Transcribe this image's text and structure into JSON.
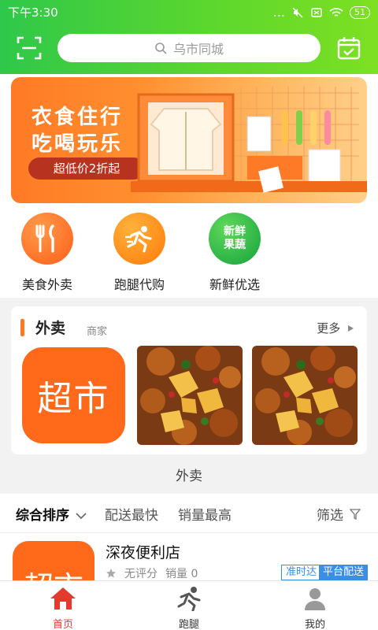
{
  "status_bar": {
    "time": "下午3:30",
    "signal": "...",
    "battery": "51"
  },
  "header": {
    "search_placeholder": "乌市同城",
    "scan_icon": "scan-icon",
    "calendar_icon": "calendar-icon"
  },
  "banner": {
    "line1": "衣食住行",
    "line2": "吃喝玩乐",
    "promo": "超低价2折起"
  },
  "categories": [
    {
      "label": "美食外卖",
      "icon": "fork-knife-icon",
      "color": "#ff6d1f"
    },
    {
      "label": "跑腿代购",
      "icon": "runner-icon",
      "color": "#ff8a14"
    },
    {
      "label": "新鲜优选",
      "icon": "fresh-produce-icon",
      "color": "#22b14c",
      "badge": "新鲜\n果蔬"
    }
  ],
  "takeaway_card": {
    "title": "外卖",
    "subtitle": "商家",
    "more": "更多",
    "items": [
      {
        "text": "超市"
      },
      {
        "kind": "food-photo"
      },
      {
        "kind": "food-photo"
      }
    ]
  },
  "section_label": "外卖",
  "sort_bar": {
    "items": [
      "综合排序",
      "配送最快",
      "销量最高"
    ],
    "filter": "筛选"
  },
  "stores": [
    {
      "thumb_text": "超市",
      "name": "深夜便利店",
      "rating": "无评分",
      "sales": "销量 0",
      "tags": [
        "准时达",
        "平台配送"
      ]
    }
  ],
  "tabbar": {
    "items": [
      "首页",
      "跑腿",
      "我的"
    ],
    "active": 0
  },
  "colors": {
    "primary_green": "#3ccf3c",
    "accent_orange": "#ff6a1a",
    "tab_active": "#e23b2e",
    "tag_blue": "#3a8ee6"
  }
}
